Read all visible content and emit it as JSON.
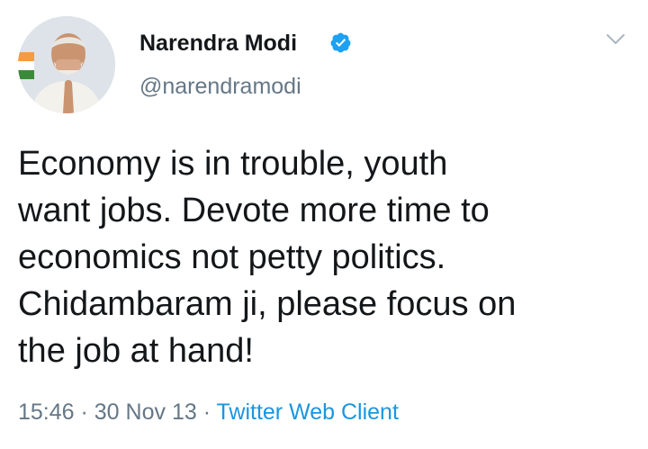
{
  "author": {
    "display_name": "Narendra Modi",
    "handle": "@narendramodi",
    "verified": true,
    "avatar_icon": "profile-photo"
  },
  "tweet": {
    "text_lines": [
      "Economy is in trouble, youth",
      "want jobs. Devote more time to",
      "economics not petty politics.",
      "Chidambaram ji, please focus on",
      "the job at hand!"
    ]
  },
  "meta": {
    "time": "15:46",
    "separator": " · ",
    "date": "30 Nov 13",
    "source": "Twitter Web Client"
  },
  "colors": {
    "text": "#14171a",
    "secondary": "#657786",
    "link": "#1b95e0",
    "verified": "#1da1f2"
  },
  "icons": {
    "verified": "verified-badge-icon",
    "menu": "chevron-down-icon"
  }
}
